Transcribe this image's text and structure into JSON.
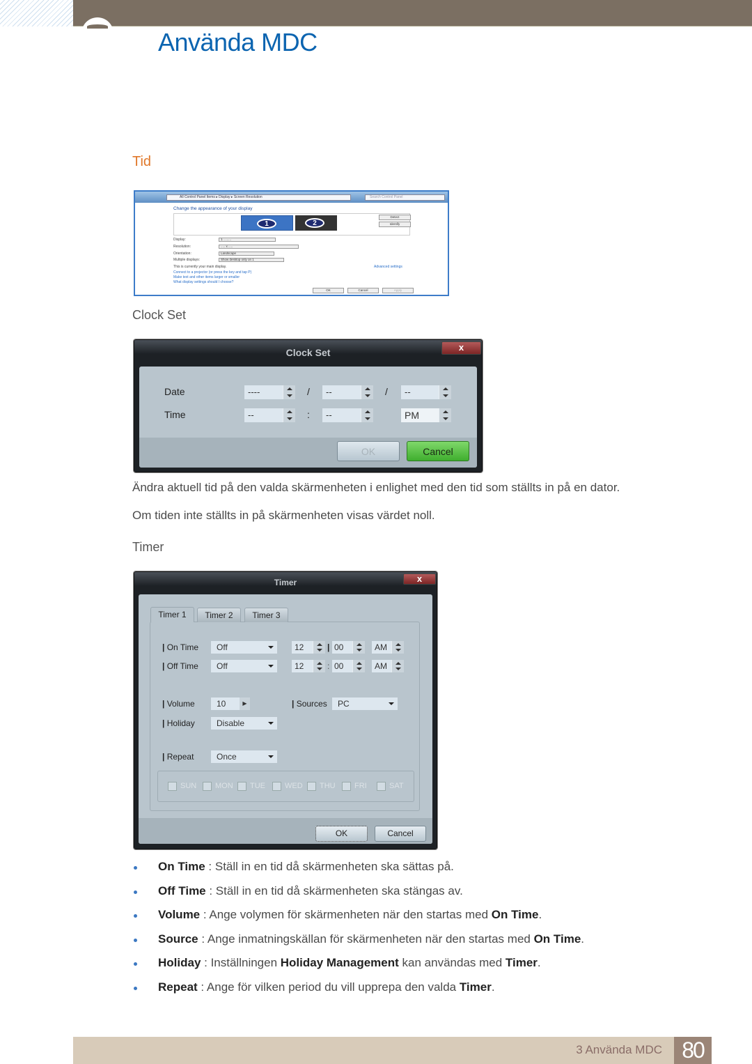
{
  "header": {
    "title": "Använda MDC",
    "accent": "#0b64b0",
    "bar_color": "#7b6f62"
  },
  "section": {
    "title": "Tid",
    "color": "#e0782a"
  },
  "screenshot": {
    "address": "All Control Panel Items ▸ Display ▸ Screen Resolution",
    "search": "Search Control Panel",
    "heading": "Change the appearance of your display",
    "detect": "Detect",
    "identify": "Identify",
    "monitor1": "1",
    "monitor2": "2",
    "rows": [
      {
        "label": "Display:",
        "value": "1. ........"
      },
      {
        "label": "Resolution:",
        "value": "..... x ....."
      },
      {
        "label": "Orientation:",
        "value": "Landscape"
      },
      {
        "label": "Multiple displays:",
        "value": "Show desktop only on 1"
      }
    ],
    "main_display": "This is currently your main display.",
    "advanced": "Advanced settings",
    "links": [
      "Connect to a projector (or press the key and tap P)",
      "Make text and other items larger or smaller",
      "What display settings should I choose?"
    ],
    "ok": "OK",
    "cancel": "Cancel",
    "apply": "Apply"
  },
  "clock_heading": "Clock Set",
  "clock_dialog": {
    "title": "Clock Set",
    "close": "x",
    "date_label": "Date",
    "time_label": "Time",
    "date": [
      "----",
      "--",
      "--"
    ],
    "date_sep": "/",
    "time": [
      "--",
      "--",
      "PM"
    ],
    "time_sep": ":",
    "ok": "OK",
    "cancel": "Cancel"
  },
  "paragraphs": [
    "Ändra aktuell tid på den valda skärmenheten i enlighet med den tid som ställts in på en dator.",
    "Om tiden inte ställts in på skärmenheten visas värdet noll."
  ],
  "timer_heading": "Timer",
  "timer_dialog": {
    "title": "Timer",
    "close": "x",
    "tabs": [
      "Timer 1",
      "Timer 2",
      "Timer 3"
    ],
    "active_tab": "Timer 1",
    "on_time": {
      "label": "On Time",
      "mode": "Off",
      "hour": "12",
      "minute": "00",
      "ampm": "AM"
    },
    "off_time": {
      "label": "Off Time",
      "mode": "Off",
      "hour": "12",
      "minute": "00",
      "ampm": "AM"
    },
    "time_sep": ":",
    "volume": {
      "label": "Volume",
      "value": "10"
    },
    "sources": {
      "label": "Sources",
      "value": "PC"
    },
    "holiday": {
      "label": "Holiday",
      "value": "Disable"
    },
    "repeat": {
      "label": "Repeat",
      "value": "Once"
    },
    "days": [
      "SUN",
      "MON",
      "TUE",
      "WED",
      "THU",
      "FRI",
      "SAT"
    ],
    "ok": "OK",
    "cancel": "Cancel"
  },
  "bullets": [
    [
      {
        "t": "On Time",
        "b": true
      },
      {
        "t": " : Ställ in en tid då skärmenheten ska sättas på."
      }
    ],
    [
      {
        "t": "Off Time",
        "b": true
      },
      {
        "t": " : Ställ in en tid då skärmenheten ska stängas av."
      }
    ],
    [
      {
        "t": "Volume",
        "b": true
      },
      {
        "t": " : Ange volymen för skärmenheten när den startas med "
      },
      {
        "t": "On Time",
        "b": true
      },
      {
        "t": "."
      }
    ],
    [
      {
        "t": "Source",
        "b": true
      },
      {
        "t": " : Ange inmatningskällan för skärmenheten när den startas med "
      },
      {
        "t": "On Time",
        "b": true
      },
      {
        "t": "."
      }
    ],
    [
      {
        "t": "Holiday",
        "b": true
      },
      {
        "t": " : Inställningen "
      },
      {
        "t": "Holiday Management",
        "b": true
      },
      {
        "t": " kan användas med "
      },
      {
        "t": "Timer",
        "b": true
      },
      {
        "t": "."
      }
    ],
    [
      {
        "t": "Repeat",
        "b": true
      },
      {
        "t": " : Ange för vilken period du vill upprepa den valda "
      },
      {
        "t": "Timer",
        "b": true
      },
      {
        "t": "."
      }
    ]
  ],
  "footer": {
    "chapter": "3 Använda MDC",
    "page": "80"
  }
}
